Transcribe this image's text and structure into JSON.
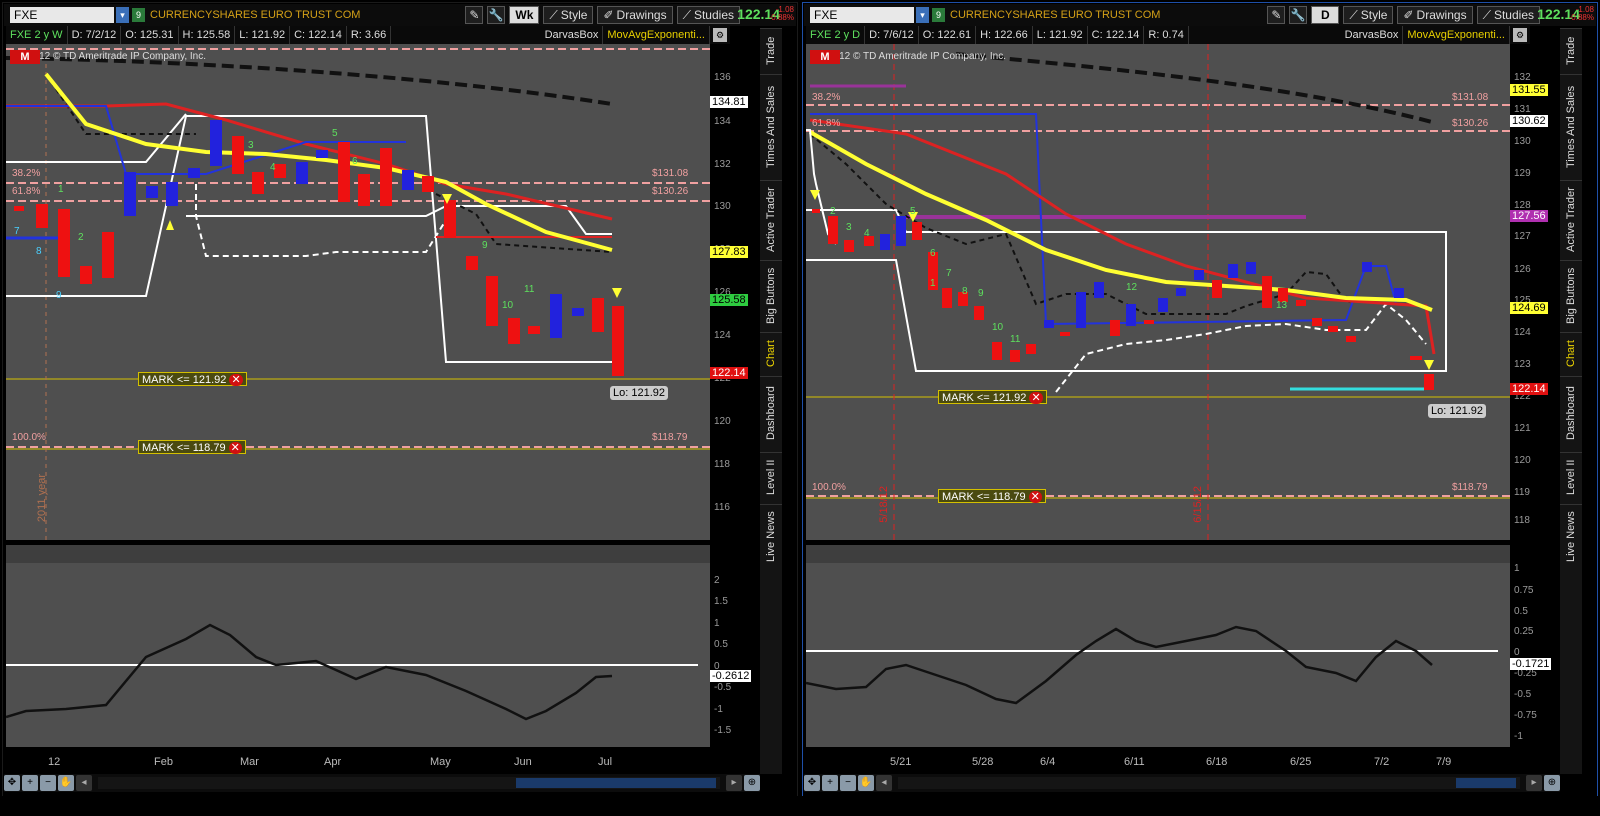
{
  "left": {
    "symbol": "FXE",
    "company": "CURRENCYSHARES EURO TRUST COM",
    "aggregation": "Wk",
    "style_label": "Style",
    "drawings_label": "Drawings",
    "studies_label": "Studies",
    "last_price": "122.14",
    "change": "-1.08",
    "change_pct": "-0.88%",
    "info": {
      "range": "FXE 2 y W",
      "date": "D: 7/2/12",
      "open": "O: 125.31",
      "high": "H: 125.58",
      "low": "L: 121.92",
      "close": "C: 122.14",
      "r": "R: 3.66"
    },
    "studies": [
      "DarvasBox",
      "MovAvgExponenti..."
    ],
    "buttons": [
      "P",
      "L",
      "LR",
      "M"
    ],
    "copyright": "2012 © TD Ameritrade IP Company, Inc.",
    "y_ticks": [
      "136",
      "134",
      "132",
      "130",
      "128",
      "126",
      "124",
      "122",
      "120",
      "118",
      "116"
    ],
    "y_tags": {
      "dash": "134.81",
      "yellow": "127.83",
      "green": "125.58",
      "last": "122.14"
    },
    "fib_labels": {
      "f382": "38.2%",
      "f618": "61.8%",
      "f100": "100.0%",
      "p1": "$131.08",
      "p2": "$130.26",
      "p3": "$118.79"
    },
    "marks": [
      "MARK <= 121.92",
      "MARK <= 118.79"
    ],
    "lo_label": "Lo: 121.92",
    "year_label": "2011 year",
    "lower_ticks": [
      "2",
      "1.5",
      "1",
      "0.5",
      "0",
      "-0.5",
      "-1",
      "-1.5"
    ],
    "lower_value": "-0.2612",
    "x_labels": [
      "12",
      "Feb",
      "Mar",
      "Apr",
      "May",
      "Jun",
      "Jul"
    ],
    "candle_numbers": [
      "1",
      "2",
      "3",
      "4",
      "5",
      "6",
      "7",
      "8",
      "9",
      "9",
      "10",
      "11"
    ]
  },
  "right": {
    "symbol": "FXE",
    "company": "CURRENCYSHARES EURO TRUST COM",
    "aggregation": "D",
    "style_label": "Style",
    "drawings_label": "Drawings",
    "studies_label": "Studies",
    "last_price": "122.14",
    "change": "-1.08",
    "change_pct": "-0.88%",
    "info": {
      "range": "FXE 2 y D",
      "date": "D: 7/6/12",
      "open": "O: 122.61",
      "high": "H: 122.66",
      "low": "L: 121.92",
      "close": "C: 122.14",
      "r": "R: 0.74"
    },
    "studies": [
      "DarvasBox",
      "MovAvgExponenti..."
    ],
    "buttons": [
      "P",
      "L",
      "LR",
      "M"
    ],
    "copyright": "2012 © TD Ameritrade IP Company, Inc.",
    "y_ticks": [
      "132",
      "131",
      "130",
      "129",
      "128",
      "127",
      "126",
      "125",
      "124",
      "123",
      "122",
      "121",
      "120",
      "119",
      "118"
    ],
    "y_tags": {
      "yellow_top": "131.55",
      "dash": "130.62",
      "purple": "127.56",
      "yellow": "124.69",
      "last": "122.14"
    },
    "fib_labels": {
      "f382": "38.2%",
      "f618": "61.8%",
      "f100": "100.0%",
      "p1": "$131.08",
      "p2": "$130.26",
      "p3": "$118.79"
    },
    "marks": [
      "MARK <= 121.92",
      "MARK <= 118.79"
    ],
    "lo_label": "Lo: 121.92",
    "vlines": [
      "5/18/12",
      "6/15/12"
    ],
    "lower_ticks": [
      "1",
      "0.75",
      "0.5",
      "0.25",
      "0",
      "-0.25",
      "-0.5",
      "-0.75",
      "-1"
    ],
    "lower_value": "-0.1721",
    "x_labels": [
      "5/21",
      "5/28",
      "6/4",
      "6/11",
      "6/18",
      "6/25",
      "7/2",
      "7/9"
    ],
    "candle_numbers": [
      "1",
      "2",
      "3",
      "4",
      "5",
      "6",
      "7",
      "8",
      "9",
      "10",
      "11",
      "12",
      "13"
    ]
  },
  "sidebar_tabs": [
    "Trade",
    "Times And Sales",
    "Active Trader",
    "Big Buttons",
    "Chart",
    "Dashboard",
    "Level II",
    "Live News"
  ],
  "active_tab": "Chart",
  "colors": {
    "up": "#2222dd",
    "down": "#ee1111",
    "ema_yellow": "#ffff33",
    "ema_red": "#dd2222",
    "darvas": "#ffffff",
    "bg": "#4f4f4f"
  }
}
